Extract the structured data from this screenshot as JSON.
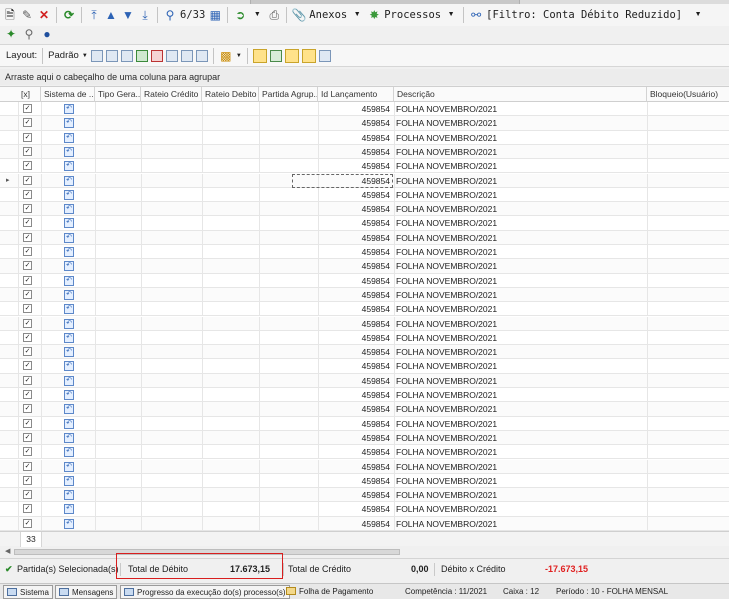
{
  "toolbar": {
    "record_counter": "6/33",
    "attachments_label": "Anexos",
    "processes_label": "Processos",
    "filter_label": "[Filtro: Conta Débito Reduzido]"
  },
  "layout_bar": {
    "label": "Layout:",
    "preset": "Padrão"
  },
  "group_hint": "Arraste aqui o cabeçalho de uma coluna para agrupar",
  "columns": [
    "[x]",
    "Sistema de ...",
    "Tipo Gera...",
    "Rateio Crédito",
    "Rateio Debito",
    "Partida Agrup...",
    "Id Lançamento",
    "Descrição",
    "Bloqueio(Usuário)"
  ],
  "rows": [
    {
      "id": "459854",
      "description": "FOLHA NOVEMBRO/2021"
    },
    {
      "id": "459854",
      "description": "FOLHA NOVEMBRO/2021"
    },
    {
      "id": "459854",
      "description": "FOLHA NOVEMBRO/2021"
    },
    {
      "id": "459854",
      "description": "FOLHA NOVEMBRO/2021"
    },
    {
      "id": "459854",
      "description": "FOLHA NOVEMBRO/2021"
    },
    {
      "id": "459854",
      "description": "FOLHA NOVEMBRO/2021"
    },
    {
      "id": "459854",
      "description": "FOLHA NOVEMBRO/2021"
    },
    {
      "id": "459854",
      "description": "FOLHA NOVEMBRO/2021"
    },
    {
      "id": "459854",
      "description": "FOLHA NOVEMBRO/2021"
    },
    {
      "id": "459854",
      "description": "FOLHA NOVEMBRO/2021"
    },
    {
      "id": "459854",
      "description": "FOLHA NOVEMBRO/2021"
    },
    {
      "id": "459854",
      "description": "FOLHA NOVEMBRO/2021"
    },
    {
      "id": "459854",
      "description": "FOLHA NOVEMBRO/2021"
    },
    {
      "id": "459854",
      "description": "FOLHA NOVEMBRO/2021"
    },
    {
      "id": "459854",
      "description": "FOLHA NOVEMBRO/2021"
    },
    {
      "id": "459854",
      "description": "FOLHA NOVEMBRO/2021"
    },
    {
      "id": "459854",
      "description": "FOLHA NOVEMBRO/2021"
    },
    {
      "id": "459854",
      "description": "FOLHA NOVEMBRO/2021"
    },
    {
      "id": "459854",
      "description": "FOLHA NOVEMBRO/2021"
    },
    {
      "id": "459854",
      "description": "FOLHA NOVEMBRO/2021"
    },
    {
      "id": "459854",
      "description": "FOLHA NOVEMBRO/2021"
    },
    {
      "id": "459854",
      "description": "FOLHA NOVEMBRO/2021"
    },
    {
      "id": "459854",
      "description": "FOLHA NOVEMBRO/2021"
    },
    {
      "id": "459854",
      "description": "FOLHA NOVEMBRO/2021"
    },
    {
      "id": "459854",
      "description": "FOLHA NOVEMBRO/2021"
    },
    {
      "id": "459854",
      "description": "FOLHA NOVEMBRO/2021"
    },
    {
      "id": "459854",
      "description": "FOLHA NOVEMBRO/2021"
    },
    {
      "id": "459854",
      "description": "FOLHA NOVEMBRO/2021"
    },
    {
      "id": "459854",
      "description": "FOLHA NOVEMBRO/2021"
    },
    {
      "id": "459854",
      "description": "FOLHA NOVEMBRO/2021"
    }
  ],
  "checkmark": "✓",
  "focused_row": 5,
  "footer_count": "33",
  "summary": {
    "selected_label": "Partida(s) Selecionada(s)",
    "debit_label": "Total de Débito",
    "debit_value": "17.673,15",
    "credit_label": "Total de Crédito",
    "credit_value": "0,00",
    "diff_label": "Débito x Crédito",
    "diff_value": "-17.673,15",
    "diff_color": "#e02020"
  },
  "statusbar": {
    "system": "Sistema",
    "messages": "Mensagens",
    "progress": "Progresso da execução do(s) processo(s)",
    "payroll": "Folha de Pagamento",
    "competence": "Competência : 11/2021",
    "cashbox": "Caixa : 12",
    "period": "Período : 10 - FOLHA MENSAL"
  }
}
